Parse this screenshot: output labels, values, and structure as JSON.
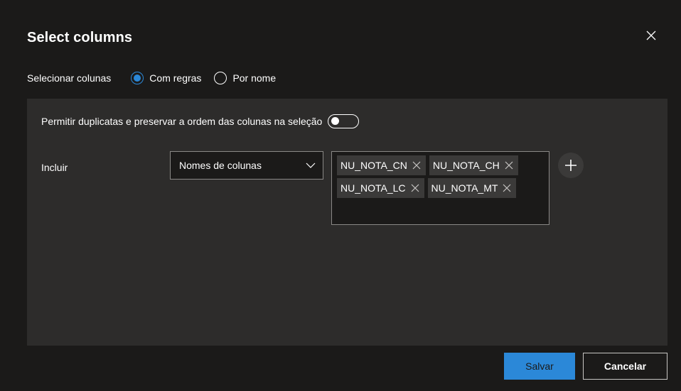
{
  "dialog": {
    "title": "Select columns",
    "close_icon": "close-icon"
  },
  "selection": {
    "label": "Selecionar colunas",
    "options": [
      {
        "label": "Com regras",
        "checked": true
      },
      {
        "label": "Por nome",
        "checked": false
      }
    ]
  },
  "rules": {
    "duplicates_label": "Permitir duplicatas e preservar a ordem das colunas na seleção",
    "duplicates_enabled": false,
    "include_label": "Incluir",
    "dropdown_value": "Nomes de colunas",
    "tags": [
      "NU_NOTA_CN",
      "NU_NOTA_CH",
      "NU_NOTA_LC",
      "NU_NOTA_MT"
    ],
    "add_icon": "plus-icon"
  },
  "footer": {
    "save_label": "Salvar",
    "cancel_label": "Cancelar"
  },
  "colors": {
    "accent": "#2b88d8",
    "background": "#1b1a19",
    "panel": "#2d2c2b",
    "tag": "#3b3a39"
  }
}
